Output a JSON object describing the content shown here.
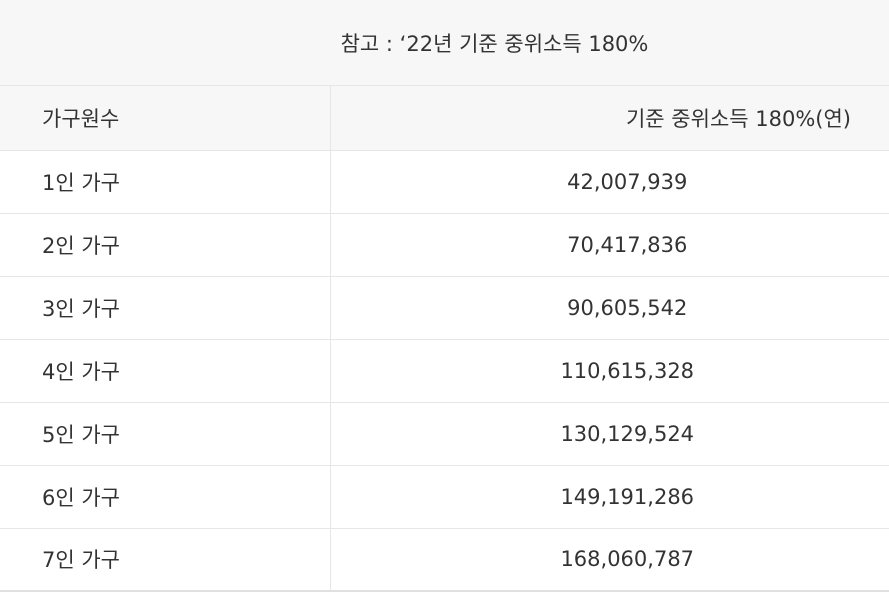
{
  "caption": "참고 : ‘22년 기준 중위소득 180%",
  "table": {
    "headers": {
      "household": "가구원수",
      "income": "기준 중위소득 180%(연)"
    },
    "rows": [
      {
        "household": "1인 가구",
        "income": "42,007,939"
      },
      {
        "household": "2인 가구",
        "income": "70,417,836"
      },
      {
        "household": "3인 가구",
        "income": "90,605,542"
      },
      {
        "household": "4인 가구",
        "income": "110,615,328"
      },
      {
        "household": "5인 가구",
        "income": "130,129,524"
      },
      {
        "household": "6인 가구",
        "income": "149,191,286"
      },
      {
        "household": "7인 가구",
        "income": "168,060,787"
      }
    ]
  }
}
